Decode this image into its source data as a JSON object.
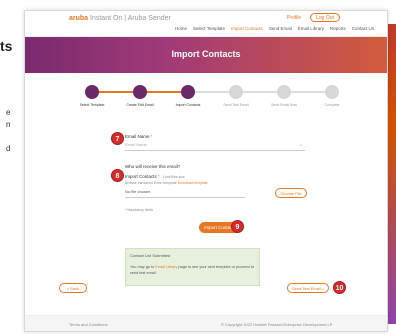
{
  "left_panel": {
    "title": "ts",
    "lines": [
      "e",
      "n",
      "d"
    ]
  },
  "header": {
    "logo_main": "aruba",
    "logo_sub": "Instant On | Aruba Sender",
    "profile": "Profile",
    "logout": "Log Out",
    "nav": [
      "Home",
      "Select Template",
      "Import Contacts",
      "Send Email",
      "Email Library",
      "Reports",
      "Contact Us"
    ]
  },
  "banner": {
    "title": "Import Contacts"
  },
  "steps": [
    {
      "label": "Select Template",
      "state": "done"
    },
    {
      "label": "Create Edit Email",
      "state": "done"
    },
    {
      "label": "Import Contacts",
      "state": "done"
    },
    {
      "label": "Send Test Email",
      "state": "pending"
    },
    {
      "label": "Send Email Now",
      "state": "pending"
    },
    {
      "label": "Complete",
      "state": "pending"
    }
  ],
  "form": {
    "email_name_label": "Email Name",
    "email_name_placeholder": "Email Name",
    "receive_question": "Who will receive this email?",
    "import_label": "Import Contacts",
    "import_hint": "Limit files size",
    "import_hint2": "Browse the saved Excel template",
    "import_link": "Download template",
    "file_name": "No file chosen",
    "choose_file": "Choose File",
    "mandatory_note": "* Mandatory fields",
    "import_button": "Import Contacts"
  },
  "success": {
    "title": "Contact List Submitted",
    "text_before": "You may go to ",
    "link": "Email Library",
    "text_after": " page to see your next template or proceed to send test email."
  },
  "badges": {
    "b7": "7",
    "b8": "8",
    "b9": "9",
    "b10": "10"
  },
  "buttons": {
    "back": "< Back",
    "send_test": "Send Test Email >"
  },
  "footer": {
    "left": "Terms and Conditions",
    "right": "© Copyright 2022 Hewlett Packard Enterprise Development LP"
  },
  "colors": {
    "accent": "#e87722",
    "banner": "#7a2b6e",
    "step_done": "#6a2a67",
    "badge": "#d62b2b",
    "success_bg": "#e7f0dd"
  }
}
